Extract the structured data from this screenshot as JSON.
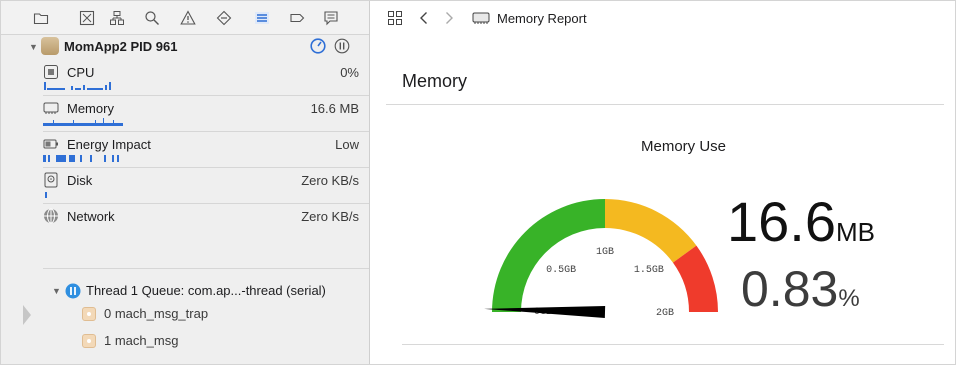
{
  "navigator": {
    "toolbar_icons": [
      "folder-icon",
      "source-control-icon",
      "symbol-icon",
      "find-icon",
      "issue-icon",
      "test-icon",
      "debug-icon",
      "breakpoint-icon",
      "report-icon"
    ],
    "process": {
      "name": "MomApp2",
      "pid": "PID 961"
    },
    "gauges": [
      {
        "label": "CPU",
        "value": "0%",
        "icon": "cpu-icon"
      },
      {
        "label": "Memory",
        "value": "16.6 MB",
        "icon": "memory-icon"
      },
      {
        "label": "Energy Impact",
        "value": "Low",
        "icon": "battery-icon"
      },
      {
        "label": "Disk",
        "value": "Zero KB/s",
        "icon": "disk-icon"
      },
      {
        "label": "Network",
        "value": "Zero KB/s",
        "icon": "network-icon"
      }
    ],
    "thread": {
      "label": "Thread 1 Queue: com.ap...-thread (serial)"
    },
    "frames": [
      {
        "label": "0 mach_msg_trap"
      },
      {
        "label": "1 mach_msg"
      }
    ]
  },
  "jumpbar": {
    "title": "Memory Report"
  },
  "report": {
    "section_title": "Memory",
    "gauge_title": "Memory Use",
    "usage_value": "16.6",
    "usage_unit": "MB",
    "percent_value": "0.83",
    "percent_unit": "%",
    "gauge_level": 0.0083,
    "gauge_ticks": [
      "0GB",
      "0.5GB",
      "1GB",
      "1.5GB",
      "2GB"
    ],
    "colors": {
      "green": "#38b328",
      "yellow": "#f4b920",
      "red": "#ef3b2c",
      "accent": "#2f6fd6"
    }
  }
}
